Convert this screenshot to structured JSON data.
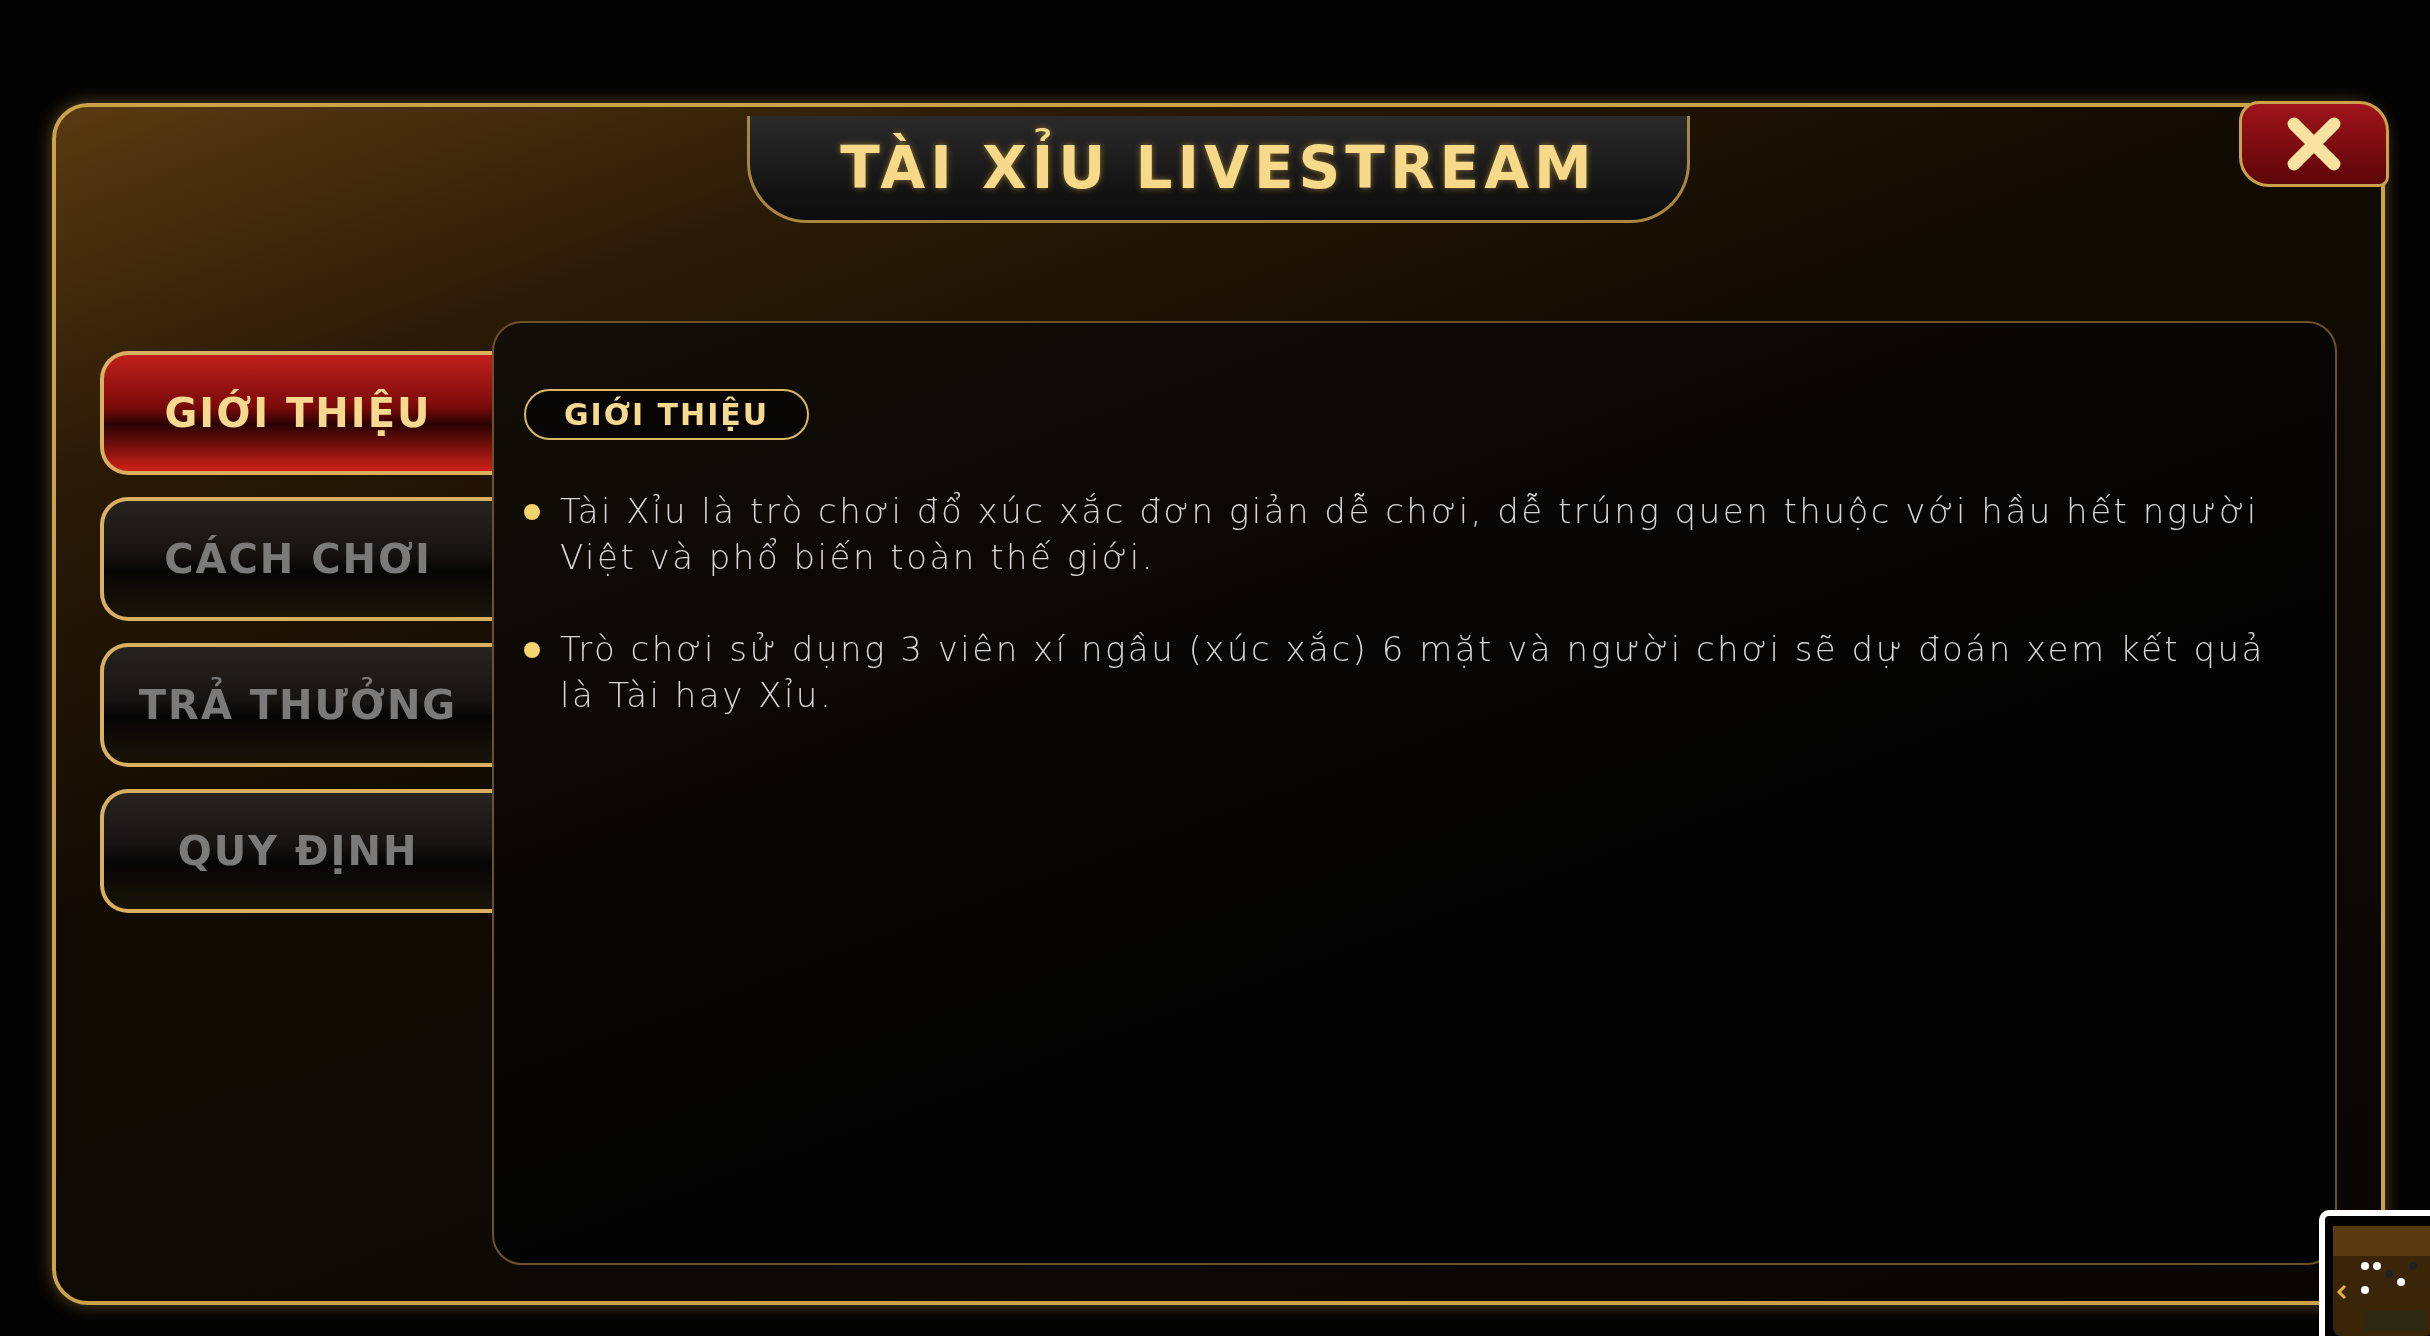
{
  "dialog": {
    "title": "TÀI XỈU LIVESTREAM"
  },
  "tabs": [
    {
      "label": "GIỚI THIỆU",
      "selected": true
    },
    {
      "label": "CÁCH CHƠI",
      "selected": false
    },
    {
      "label": "TRẢ THƯỞNG",
      "selected": false
    },
    {
      "label": "QUY ĐỊNH",
      "selected": false
    }
  ],
  "content": {
    "heading": "GIỚI THIỆU",
    "paragraphs": [
      "Tài Xỉu là trò chơi đổ xúc xắc đơn giản dễ chơi, dễ trúng quen thuộc với hầu hết người Việt và phổ biến toàn thế giới.",
      "Trò chơi sử dụng 3 viên xí ngầu (xúc xắc) 6 mặt và người chơi sẽ dự đoán xem kết quả là Tài hay Xỉu."
    ]
  }
}
